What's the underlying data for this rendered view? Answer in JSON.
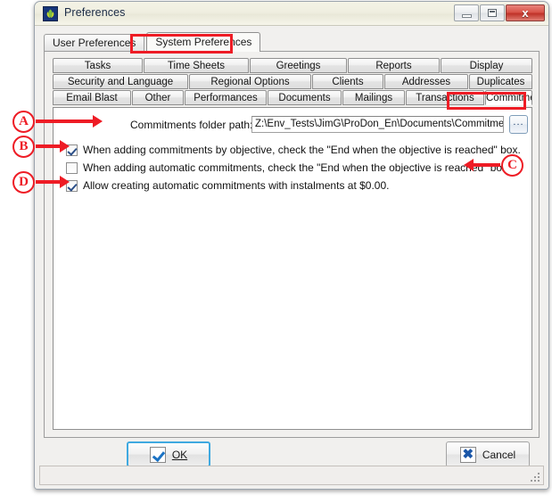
{
  "window": {
    "title": "Preferences",
    "icon": "app-logo-icon",
    "controls": {
      "minimize": "minimize-icon",
      "maximize": "maximize-icon",
      "close_label": "x"
    }
  },
  "primary_tabs": [
    {
      "label": "User Preferences",
      "selected": false
    },
    {
      "label": "System Preferences",
      "selected": true
    }
  ],
  "secondary_tab_rows": [
    [
      {
        "label": "Tasks",
        "selected": false
      },
      {
        "label": "Time Sheets",
        "selected": false
      },
      {
        "label": "Greetings",
        "selected": false
      },
      {
        "label": "Reports",
        "selected": false
      },
      {
        "label": "Display",
        "selected": false
      }
    ],
    [
      {
        "label": "Security and Language",
        "selected": false
      },
      {
        "label": "Regional Options",
        "selected": false
      },
      {
        "label": "Clients",
        "selected": false
      },
      {
        "label": "Addresses",
        "selected": false
      },
      {
        "label": "Duplicates",
        "selected": false
      }
    ],
    [
      {
        "label": "Email Blast",
        "selected": false
      },
      {
        "label": "Other",
        "selected": false
      },
      {
        "label": "Performances",
        "selected": false
      },
      {
        "label": "Documents",
        "selected": false
      },
      {
        "label": "Mailings",
        "selected": false
      },
      {
        "label": "Transactions",
        "selected": false
      },
      {
        "label": "Commitments",
        "selected": true
      }
    ]
  ],
  "form": {
    "folder_path_label": "Commitments folder path:",
    "folder_path_value": "Z:\\Env_Tests\\JimG\\ProDon_En\\Documents\\Commitment\\",
    "browse_button_label": "...",
    "checkboxes": [
      {
        "label": "When adding commitments by objective, check the \"End when the objective is reached\" box.",
        "checked": true
      },
      {
        "label": "When adding automatic commitments, check the \"End when the objective is reached\" box.",
        "checked": false
      },
      {
        "label": "Allow creating automatic commitments with instalments at $0.00.",
        "checked": true
      }
    ]
  },
  "buttons": {
    "ok": {
      "label": "OK",
      "icon": "checkmark-icon"
    },
    "cancel": {
      "label": "Cancel",
      "icon": "cross-icon"
    }
  },
  "annotations": [
    {
      "letter": "A",
      "target": "folder-path-field"
    },
    {
      "letter": "B",
      "target": "checkbox-objective"
    },
    {
      "letter": "C",
      "target": "checkbox-automatic"
    },
    {
      "letter": "D",
      "target": "checkbox-instalments"
    }
  ],
  "colors": {
    "annotation_red": "#ee1c25",
    "title_bar": "#efeee0",
    "panel_white": "#ffffff",
    "primary_button_border": "#3fa9e0"
  }
}
